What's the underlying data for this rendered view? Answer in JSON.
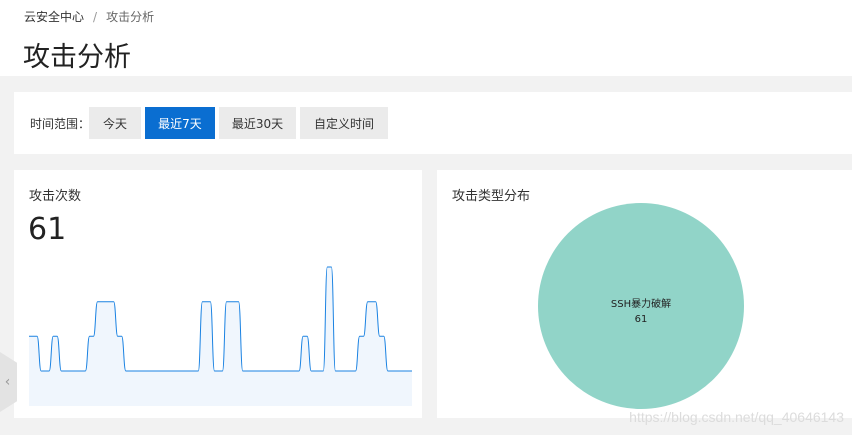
{
  "breadcrumb": {
    "root": "云安全中心",
    "separator": "/",
    "current": "攻击分析"
  },
  "page": {
    "title": "攻击分析"
  },
  "filter": {
    "label": "时间范围：",
    "options": [
      {
        "label": "今天",
        "active": false
      },
      {
        "label": "最近7天",
        "active": true
      },
      {
        "label": "最近30天",
        "active": false
      },
      {
        "label": "自定义时间",
        "active": false
      }
    ]
  },
  "attack_count": {
    "title": "攻击次数",
    "value": "61"
  },
  "attack_types": {
    "title": "攻击类型分布",
    "slice_label": "SSH暴力破解",
    "slice_value": "61"
  },
  "colors": {
    "accent": "#0a6ed1",
    "line": "#1a82e2",
    "pie": "#91d4c8"
  },
  "watermark": "https://blog.csdn.net/qq_40646143",
  "chart_data": [
    {
      "type": "line",
      "title": "攻击次数",
      "x": [
        0,
        1,
        2,
        3,
        4,
        5,
        6,
        7,
        8,
        9,
        10,
        11,
        12,
        13,
        14,
        15,
        16,
        17,
        18,
        19,
        20,
        21,
        22,
        23,
        24,
        25,
        26,
        27,
        28,
        29,
        30,
        31,
        32,
        33,
        34,
        35,
        36,
        37,
        38,
        39,
        40,
        41,
        42,
        43,
        44,
        45,
        46,
        47,
        48,
        49,
        50,
        51,
        52,
        53,
        54,
        55,
        56,
        57,
        58,
        59,
        60,
        61,
        62,
        63,
        64,
        65,
        66,
        67,
        68,
        69,
        70,
        71,
        72,
        73,
        74,
        75,
        76,
        77,
        78,
        79,
        80,
        81,
        82,
        83,
        84,
        85,
        86,
        87,
        88,
        89,
        90,
        91,
        92,
        93,
        94,
        95
      ],
      "values": [
        1,
        1,
        1,
        0,
        0,
        0,
        1,
        1,
        0,
        0,
        0,
        0,
        0,
        0,
        0,
        1,
        1,
        2,
        2,
        2,
        2,
        2,
        1,
        1,
        0,
        0,
        0,
        0,
        0,
        0,
        0,
        0,
        0,
        0,
        0,
        0,
        0,
        0,
        0,
        0,
        0,
        0,
        0,
        2,
        2,
        2,
        0,
        0,
        0,
        2,
        2,
        2,
        2,
        0,
        0,
        0,
        0,
        0,
        0,
        0,
        0,
        0,
        0,
        0,
        0,
        0,
        0,
        0,
        1,
        1,
        0,
        0,
        0,
        0,
        3,
        3,
        0,
        0,
        0,
        0,
        0,
        0,
        1,
        1,
        2,
        2,
        2,
        1,
        1,
        0,
        0,
        0,
        0,
        0,
        0,
        0
      ],
      "ylim": [
        0,
        3
      ],
      "grid": false
    },
    {
      "type": "pie",
      "title": "攻击类型分布",
      "labels": [
        "SSH暴力破解"
      ],
      "values": [
        61
      ]
    }
  ]
}
